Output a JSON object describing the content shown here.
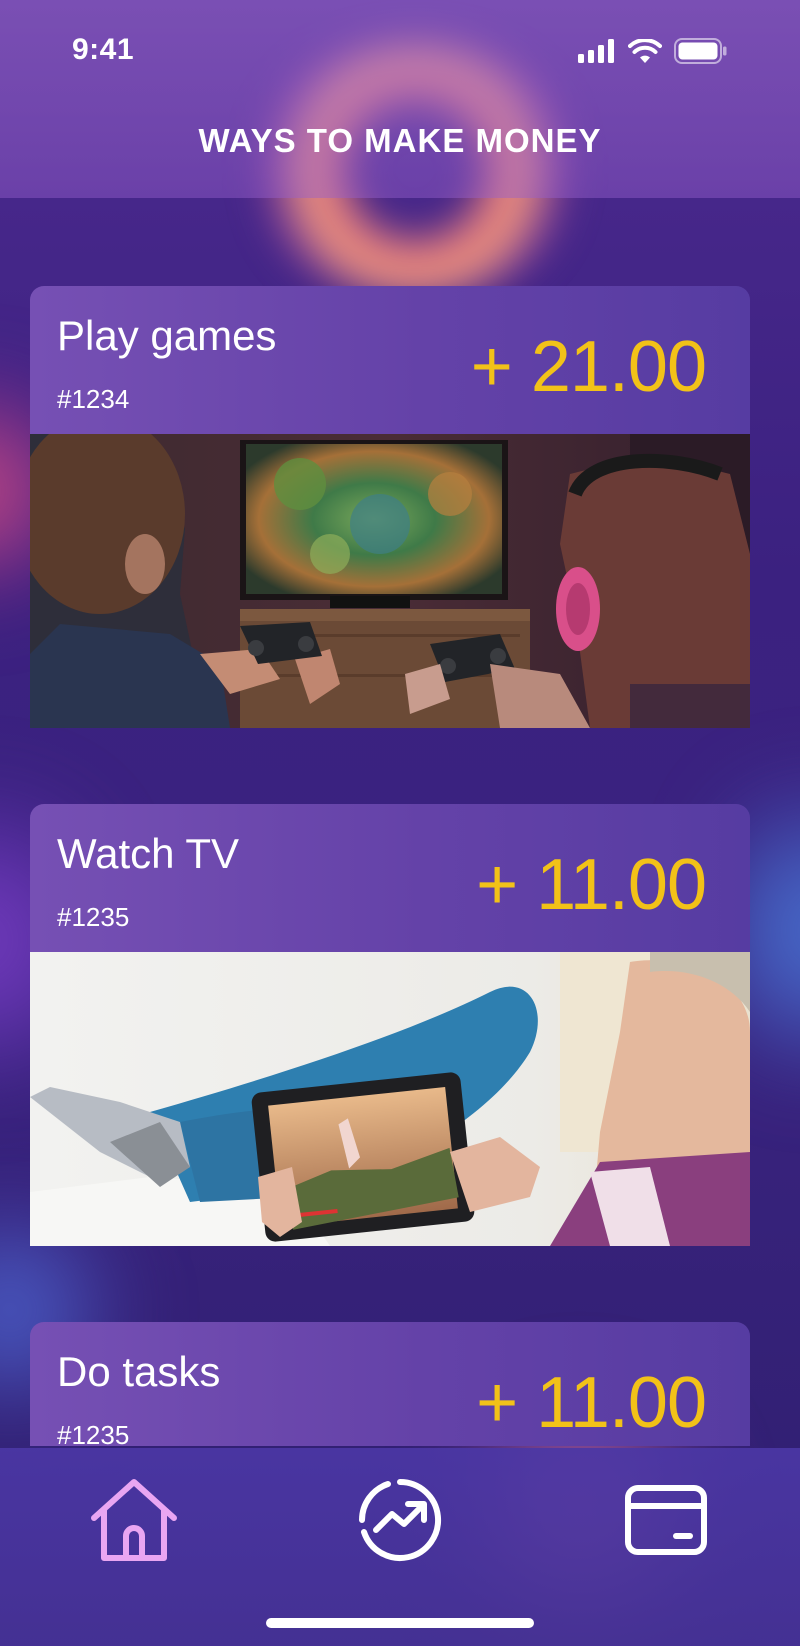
{
  "status_bar": {
    "time": "9:41"
  },
  "header": {
    "title": "WAYS TO MAKE MONEY"
  },
  "cards": [
    {
      "title": "Play games",
      "id": "#1234",
      "reward": "+ 21.00",
      "image": "people-playing-video-games-photo"
    },
    {
      "title": "Watch TV",
      "id": "#1235",
      "reward": "+ 11.00",
      "image": "person-watching-tablet-photo"
    },
    {
      "title": "Do tasks",
      "id": "#1235",
      "reward": "+ 11.00",
      "image": ""
    }
  ],
  "tabbar": {
    "tabs": [
      {
        "icon": "home-icon",
        "active": true
      },
      {
        "icon": "trending-icon",
        "active": false
      },
      {
        "icon": "wallet-card-icon",
        "active": false
      }
    ]
  },
  "colors": {
    "reward": "#f2c218",
    "active_tab": "#e9a6f2",
    "card_header": "#6442a8"
  }
}
